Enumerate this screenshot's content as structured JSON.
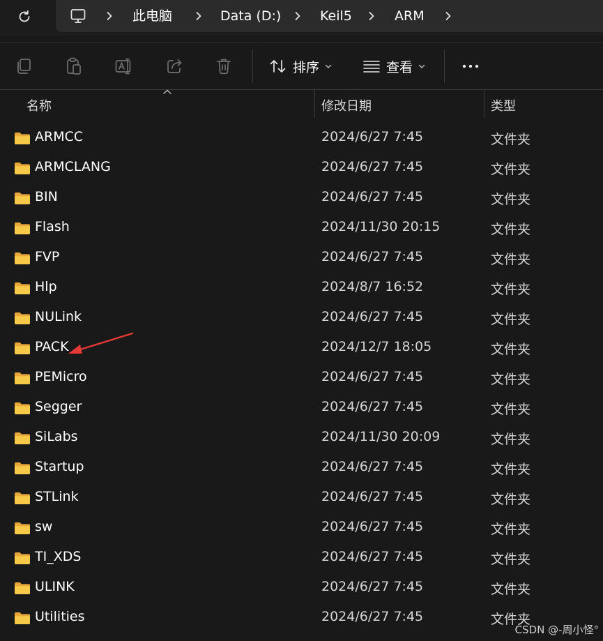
{
  "address_bar": {
    "refresh_icon": "refresh-icon",
    "computer_icon": "computer-icon",
    "separator_icon": "chevron-right-icon",
    "breadcrumbs": [
      "此电脑",
      "Data (D:)",
      "Keil5",
      "ARM"
    ]
  },
  "command_bar": {
    "buttons": [
      {
        "name": "copy",
        "icon": "copy-icon"
      },
      {
        "name": "paste",
        "icon": "paste-icon"
      },
      {
        "name": "rename",
        "icon": "rename-icon"
      },
      {
        "name": "share",
        "icon": "share-icon"
      },
      {
        "name": "delete",
        "icon": "trash-icon"
      }
    ],
    "sort_label": "排序",
    "view_label": "查看",
    "more_icon": "more-icon"
  },
  "columns": {
    "name": "名称",
    "modified": "修改日期",
    "type": "类型"
  },
  "files": [
    {
      "name": "ARMCC",
      "modified": "2024/6/27 7:45",
      "type": "文件夹"
    },
    {
      "name": "ARMCLANG",
      "modified": "2024/6/27 7:45",
      "type": "文件夹"
    },
    {
      "name": "BIN",
      "modified": "2024/6/27 7:45",
      "type": "文件夹"
    },
    {
      "name": "Flash",
      "modified": "2024/11/30 20:15",
      "type": "文件夹"
    },
    {
      "name": "FVP",
      "modified": "2024/6/27 7:45",
      "type": "文件夹"
    },
    {
      "name": "Hlp",
      "modified": "2024/8/7 16:52",
      "type": "文件夹"
    },
    {
      "name": "NULink",
      "modified": "2024/6/27 7:45",
      "type": "文件夹"
    },
    {
      "name": "PACK",
      "modified": "2024/12/7 18:05",
      "type": "文件夹"
    },
    {
      "name": "PEMicro",
      "modified": "2024/6/27 7:45",
      "type": "文件夹"
    },
    {
      "name": "Segger",
      "modified": "2024/6/27 7:45",
      "type": "文件夹"
    },
    {
      "name": "SiLabs",
      "modified": "2024/11/30 20:09",
      "type": "文件夹"
    },
    {
      "name": "Startup",
      "modified": "2024/6/27 7:45",
      "type": "文件夹"
    },
    {
      "name": "STLink",
      "modified": "2024/6/27 7:45",
      "type": "文件夹"
    },
    {
      "name": "sw",
      "modified": "2024/6/27 7:45",
      "type": "文件夹"
    },
    {
      "name": "TI_XDS",
      "modified": "2024/6/27 7:45",
      "type": "文件夹"
    },
    {
      "name": "ULINK",
      "modified": "2024/6/27 7:45",
      "type": "文件夹"
    },
    {
      "name": "Utilities",
      "modified": "2024/6/27 7:45",
      "type": "文件夹"
    }
  ],
  "annotation": {
    "arrow_color": "#e53935",
    "points_to": "PACK"
  },
  "watermark": "CSDN @-周小怪°",
  "colors": {
    "background": "#191919",
    "address_bar": "#2b2b2b",
    "folder": "#f5c343",
    "text": "#ffffff"
  }
}
